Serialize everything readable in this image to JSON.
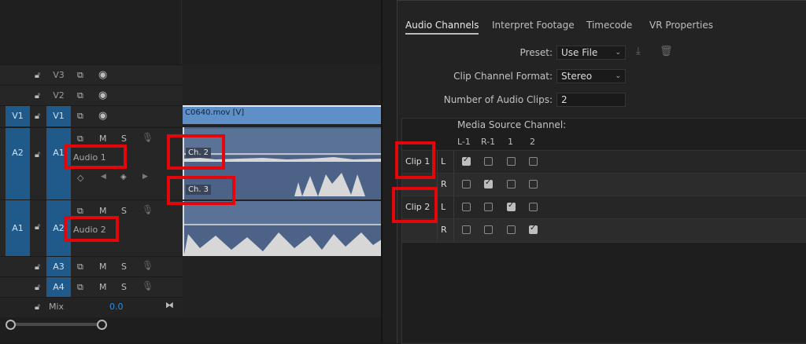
{
  "timeline": {
    "tracks": [
      {
        "src": "",
        "id": "V3"
      },
      {
        "src": "",
        "id": "V2"
      },
      {
        "src": "V1",
        "id": "V1"
      },
      {
        "src": "A2",
        "id": "A1",
        "name": "Audio 1"
      },
      {
        "src": "A1",
        "id": "A2",
        "name": "Audio 2"
      },
      {
        "src": "",
        "id": "A3"
      },
      {
        "src": "",
        "id": "A4"
      }
    ],
    "track_buttons": {
      "mute": "M",
      "solo": "S"
    },
    "mix": {
      "label": "Mix",
      "value": "0.0"
    },
    "video_clip": "C0640.mov [V]",
    "channel_labels": [
      "Ch. 2",
      "Ch. 3"
    ]
  },
  "dialog": {
    "tabs": [
      "Audio Channels",
      "Interpret Footage",
      "Timecode",
      "VR Properties"
    ],
    "preset": {
      "label": "Preset:",
      "value": "Use File"
    },
    "clip_channel_format": {
      "label": "Clip Channel Format:",
      "value": "Stereo"
    },
    "num_audio_clips": {
      "label": "Number of Audio Clips:",
      "value": "2"
    },
    "table": {
      "header": "Media Source Channel:",
      "columns": [
        "L-1",
        "R-1",
        "1",
        "2"
      ],
      "clips": [
        {
          "name": "Clip 1",
          "rows": [
            {
              "ch": "L",
              "checks": [
                true,
                false,
                false,
                false
              ]
            },
            {
              "ch": "R",
              "checks": [
                false,
                true,
                false,
                false
              ]
            }
          ]
        },
        {
          "name": "Clip 2",
          "rows": [
            {
              "ch": "L",
              "checks": [
                false,
                false,
                true,
                false
              ]
            },
            {
              "ch": "R",
              "checks": [
                false,
                false,
                false,
                true
              ]
            }
          ]
        }
      ]
    }
  }
}
